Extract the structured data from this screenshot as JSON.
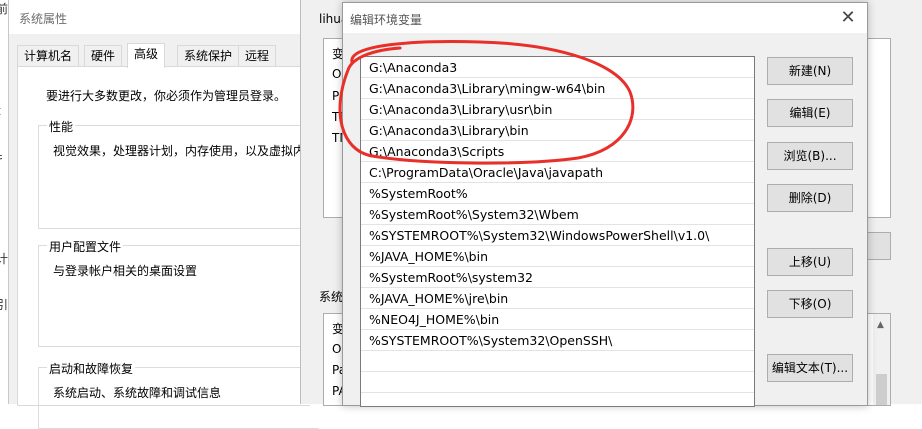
{
  "desktop": {
    "fragments": [
      "前",
      "t",
      "扌",
      "计",
      "引"
    ]
  },
  "system_properties": {
    "title": "系统属性",
    "tabs": [
      {
        "label": "计算机名"
      },
      {
        "label": "硬件"
      },
      {
        "label": "高级",
        "active": true
      },
      {
        "label": "系统保护"
      },
      {
        "label": "远程"
      }
    ],
    "admin_note": "要进行大多数更改，你必须作为管理员登录。",
    "groups": [
      {
        "title": "性能",
        "text": "视觉效果，处理器计划，内存使用，以及虚拟内"
      },
      {
        "title": "用户配置文件",
        "text": "与登录帐户相关的桌面设置"
      },
      {
        "title": "启动和故障恢复",
        "text": "系统启动、系统故障和调试信息"
      }
    ]
  },
  "env_vars": {
    "user_label": "lihua",
    "user_rows": [
      "变",
      "O",
      "Pa",
      "TE",
      "TM"
    ],
    "system_label": "系统",
    "system_rows": [
      "变",
      "O",
      "Pa",
      "PA"
    ]
  },
  "edit_dialog": {
    "title": "编辑环境变量",
    "close": "✕",
    "paths": [
      "G:\\Anaconda3",
      "G:\\Anaconda3\\Library\\mingw-w64\\bin",
      "G:\\Anaconda3\\Library\\usr\\bin",
      "G:\\Anaconda3\\Library\\bin",
      "G:\\Anaconda3\\Scripts",
      "C:\\ProgramData\\Oracle\\Java\\javapath",
      "%SystemRoot%",
      "%SystemRoot%\\System32\\Wbem",
      "%SYSTEMROOT%\\System32\\WindowsPowerShell\\v1.0\\",
      "%JAVA_HOME%\\bin",
      "%SystemRoot%\\system32",
      "%JAVA_HOME%\\jre\\bin",
      "%NEO4J_HOME%\\bin",
      "%SYSTEMROOT%\\System32\\OpenSSH\\"
    ],
    "buttons": {
      "new": "新建(N)",
      "edit": "编辑(E)",
      "browse": "浏览(B)...",
      "delete": "删除(D)",
      "move_up": "上移(U)",
      "move_down": "下移(O)",
      "edit_text": "编辑文本(T)..."
    },
    "annotation_color": "#e8302a"
  }
}
